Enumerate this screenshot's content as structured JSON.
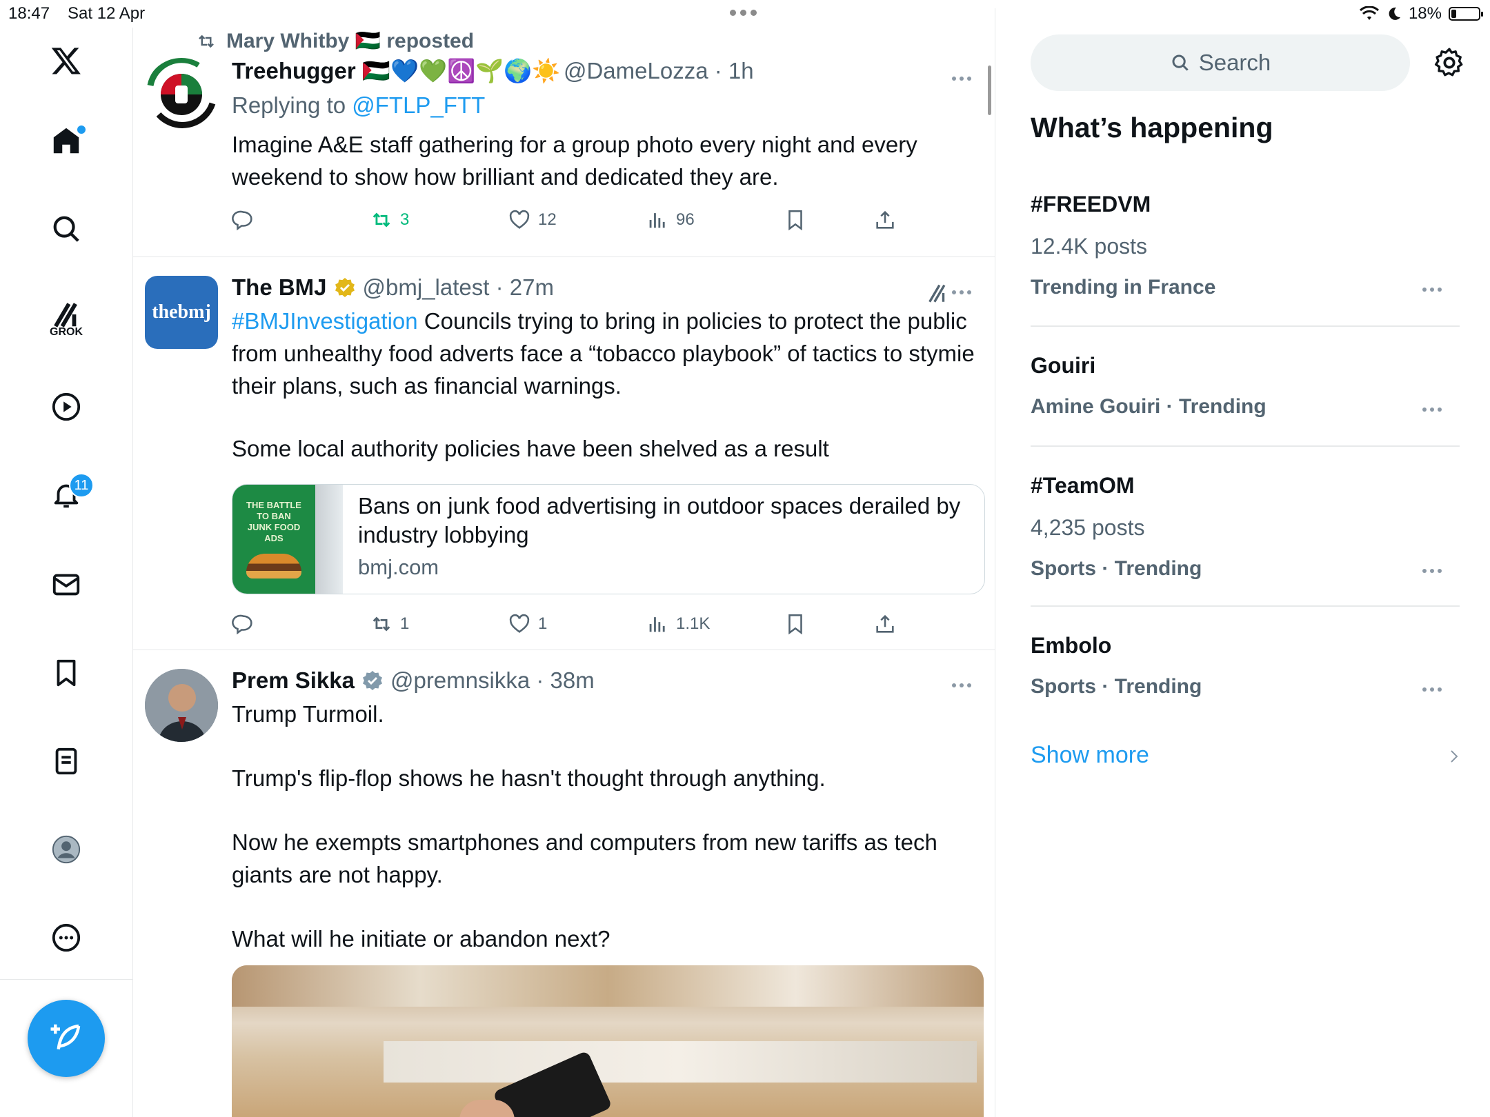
{
  "status": {
    "time": "18:47",
    "date": "Sat 12 Apr",
    "battery": "18%",
    "battery_level": 0.18
  },
  "nav": {
    "notifications_badge": "11",
    "grok_label": "GROK"
  },
  "feed": {
    "posts": [
      {
        "repost_by": "Mary Whitby 🇵🇸 reposted",
        "name": "Treehugger 🇵🇸💙💚☮️🌱🌍☀️",
        "handle": "@DameLozza · 1h",
        "replying_prefix": "Replying to ",
        "replying_to": "@FTLP_FTT",
        "text": "Imagine A&E staff gathering for a group photo every night and every weekend to show how brilliant and dedicated they are.",
        "stats": {
          "reposts": "3",
          "likes": "12",
          "views": "96"
        }
      },
      {
        "name": "The BMJ",
        "handle": "@bmj_latest · 27m",
        "avatar_text": "thebmj",
        "hashtag": "#BMJInvestigation",
        "text_1": " Councils trying to bring in policies to protect the public from unhealthy food adverts face a “tobacco playbook” of tactics to stymie their plans, such as financial warnings.",
        "text_2": "Some local authority policies have been shelved as a result",
        "card": {
          "title": "Bans on junk food advertising in outdoor spaces derailed by industry lobbying",
          "domain": "bmj.com",
          "thumb_text": "THE BATTLE TO BAN JUNK FOOD ADS"
        },
        "stats": {
          "reposts": "1",
          "likes": "1",
          "views": "1.1K"
        }
      },
      {
        "name": "Prem Sikka",
        "handle": "@premnsikka · 38m",
        "paragraphs": [
          "Trump Turmoil.",
          "Trump's flip-flop shows he hasn't thought through anything.",
          "Now he exempts smartphones and computers from new tariffs as tech giants are not happy.",
          "What will he initiate or abandon next?"
        ]
      }
    ]
  },
  "sidebar": {
    "search_placeholder": "Search",
    "section_title": "What’s happening",
    "trends": [
      {
        "title": "#FREEDVM",
        "posts": "12.4K posts",
        "context": "Trending in France"
      },
      {
        "title": "Gouiri",
        "context": "Amine Gouiri · Trending"
      },
      {
        "title": "#TeamOM",
        "posts": "4,235 posts",
        "context": "Sports · Trending"
      },
      {
        "title": "Embolo",
        "context": "Sports · Trending"
      }
    ],
    "show_more": "Show more"
  },
  "colors": {
    "accent": "#1d9bf0",
    "repost_green": "#00ba7c",
    "muted": "#536471",
    "gold_badge": "#e2b719"
  }
}
